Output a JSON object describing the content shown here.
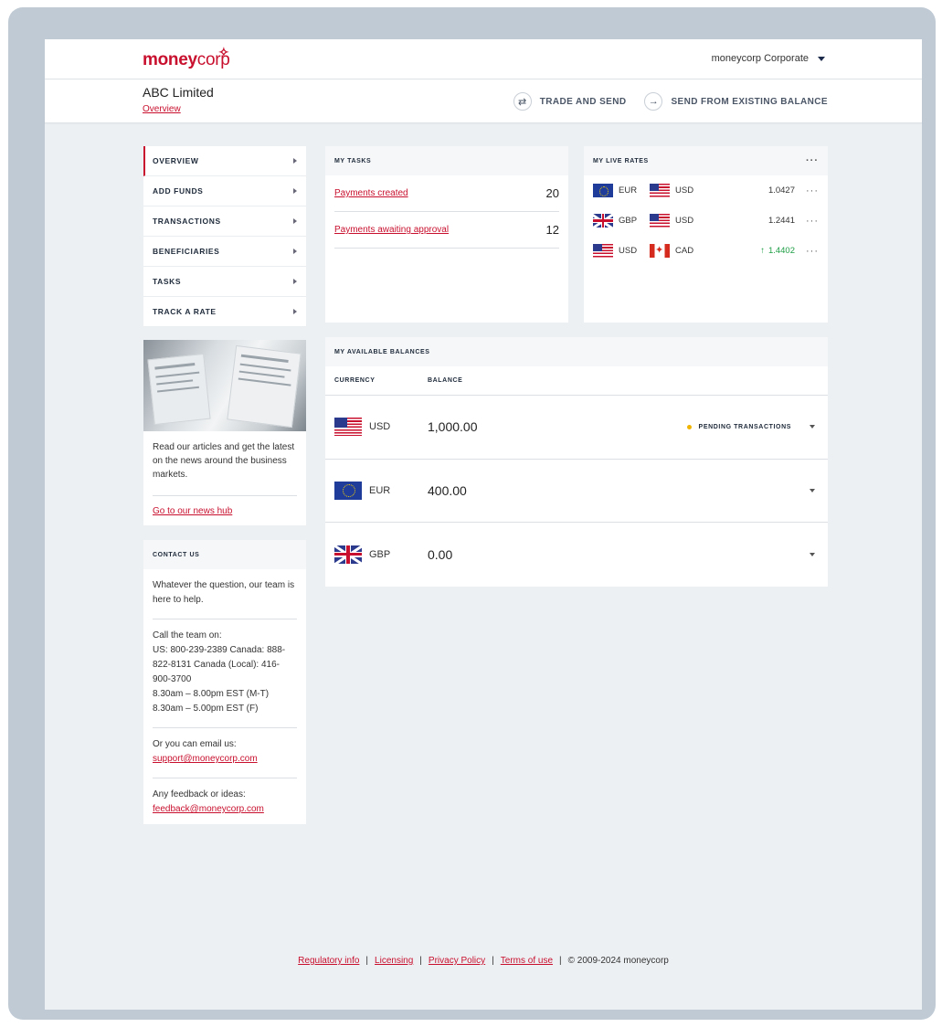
{
  "header": {
    "logo_text_money": "money",
    "logo_text_corp": "corp",
    "account_label": "moneycorp Corporate"
  },
  "subheader": {
    "company_name": "ABC Limited",
    "breadcrumb": "Overview",
    "actions": [
      {
        "label": "TRADE AND SEND",
        "icon": "swap-arrows-icon"
      },
      {
        "label": "SEND FROM EXISTING BALANCE",
        "icon": "arrow-right-icon"
      }
    ]
  },
  "sidebar": {
    "items": [
      {
        "label": "OVERVIEW",
        "active": true
      },
      {
        "label": "ADD FUNDS"
      },
      {
        "label": "TRANSACTIONS"
      },
      {
        "label": "BENEFICIARIES"
      },
      {
        "label": "TASKS"
      },
      {
        "label": "TRACK A RATE"
      }
    ]
  },
  "news": {
    "text": "Read our articles and get the latest on the news around the business markets.",
    "link": "Go to our news hub"
  },
  "contact": {
    "title": "CONTACT US",
    "intro": "Whatever the question, our team is here to help.",
    "call_heading": "Call the team on:",
    "call_details": "US: 800-239-2389 Canada: 888-822-8131 Canada (Local): 416-900-3700",
    "hours": "8.30am – 8.00pm EST (M-T) 8.30am – 5.00pm EST (F)",
    "email_heading": "Or you can email us:",
    "email": "support@moneycorp.com",
    "feedback_heading": "Any feedback or ideas:",
    "feedback_email": "feedback@moneycorp.com"
  },
  "tasks": {
    "title": "MY TASKS",
    "rows": [
      {
        "label": "Payments created",
        "count": "20"
      },
      {
        "label": "Payments awaiting approval",
        "count": "12"
      }
    ]
  },
  "rates": {
    "title": "MY LIVE RATES",
    "menu": "···",
    "rows": [
      {
        "from": "EUR",
        "to": "USD",
        "rate": "1.0427",
        "trend": "none"
      },
      {
        "from": "GBP",
        "to": "USD",
        "rate": "1.2441",
        "trend": "none"
      },
      {
        "from": "USD",
        "to": "CAD",
        "rate": "1.4402",
        "trend": "up"
      }
    ]
  },
  "balances": {
    "title": "MY AVAILABLE BALANCES",
    "col_currency": "CURRENCY",
    "col_balance": "BALANCE",
    "pending_label": "PENDING TRANSACTIONS",
    "rows": [
      {
        "currency": "USD",
        "amount": "1,000.00",
        "pending": true
      },
      {
        "currency": "EUR",
        "amount": "400.00",
        "pending": false
      },
      {
        "currency": "GBP",
        "amount": "0.00",
        "pending": false
      }
    ]
  },
  "footer": {
    "links": [
      "Regulatory info",
      "Licensing",
      "Privacy Policy",
      "Terms of use"
    ],
    "separator": "|",
    "copyright": "© 2009-2024 moneycorp"
  },
  "colors": {
    "brand": "#c8102e",
    "up": "#1e9e45",
    "pending_dot": "#f0b400"
  }
}
